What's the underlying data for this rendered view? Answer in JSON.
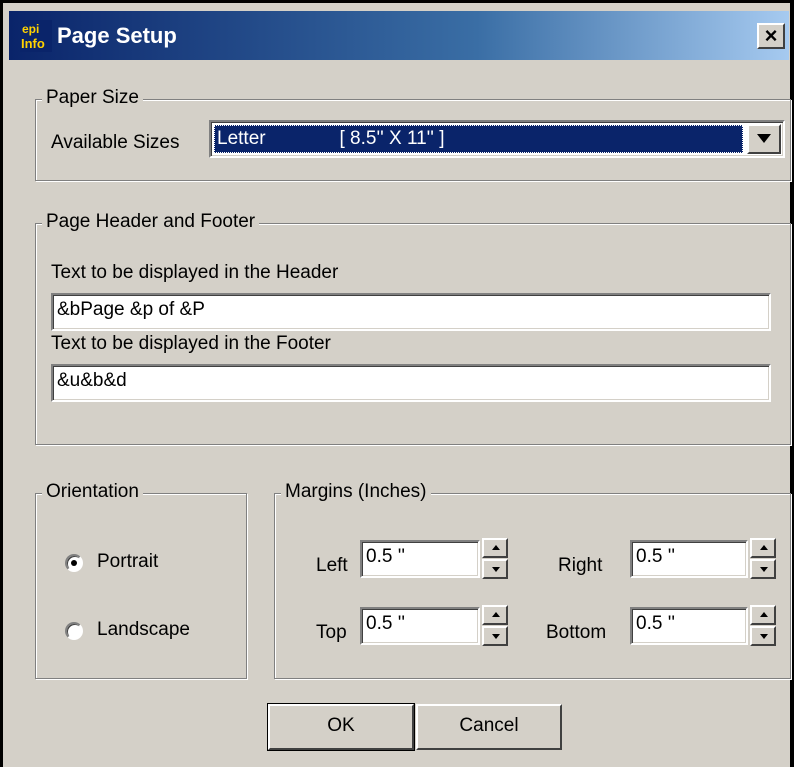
{
  "window": {
    "title": "Page Setup",
    "app_icon": "epi-info-icon",
    "close_glyph": "×"
  },
  "paper_size": {
    "group_label": "Paper Size",
    "available_sizes_label": "Available Sizes",
    "selected_value": "Letter              [ 8.5'' X 11'' ]"
  },
  "header_footer": {
    "group_label": "Page Header and Footer",
    "header_label": "Text to be displayed in the Header",
    "header_value": "&bPage &p of &P",
    "footer_label": "Text to be displayed in the Footer",
    "footer_value": "&u&b&d"
  },
  "orientation": {
    "group_label": "Orientation",
    "options": [
      {
        "label": "Portrait",
        "selected": true
      },
      {
        "label": "Landscape",
        "selected": false
      }
    ]
  },
  "margins": {
    "group_label": "Margins (Inches)",
    "left_label": "Left",
    "left_value": "0.5 ''",
    "right_label": "Right",
    "right_value": "0.5 ''",
    "top_label": "Top",
    "top_value": "0.5 ''",
    "bottom_label": "Bottom",
    "bottom_value": "0.5 ''"
  },
  "buttons": {
    "ok_label": "OK",
    "cancel_label": "Cancel"
  },
  "colors": {
    "titlebar_start": "#0a246a",
    "titlebar_end": "#a6caf0",
    "dialog_bg": "#d4d0c8",
    "selection_bg": "#0a246a"
  }
}
